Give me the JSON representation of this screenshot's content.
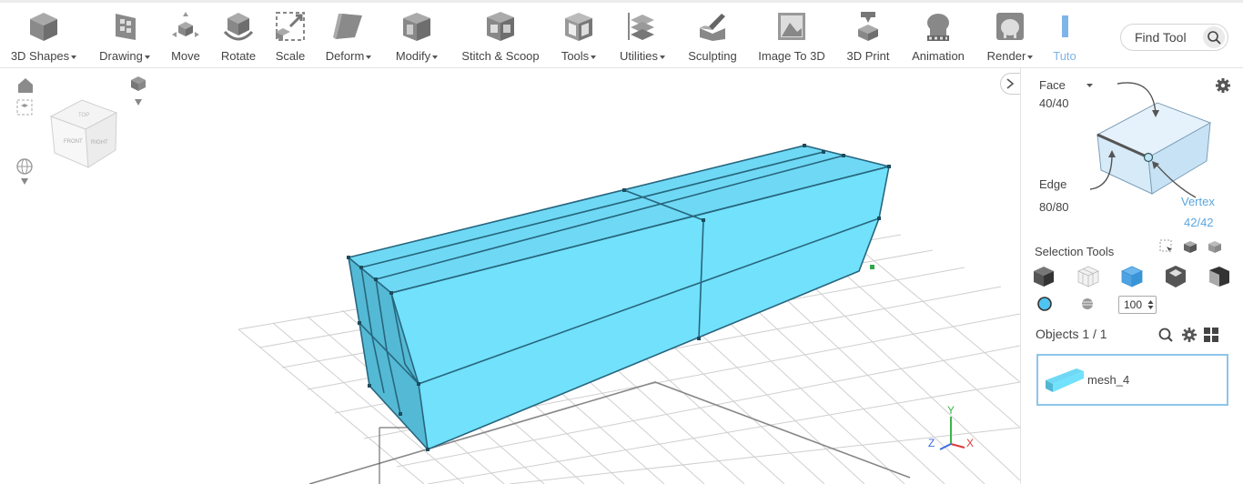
{
  "toolbar": {
    "tools": [
      {
        "label": "3D Shapes",
        "dropdown": true,
        "icon": "cube-icon"
      },
      {
        "label": "Drawing",
        "dropdown": true,
        "icon": "drawing-icon"
      },
      {
        "label": "Move",
        "dropdown": false,
        "icon": "move-icon"
      },
      {
        "label": "Rotate",
        "dropdown": false,
        "icon": "rotate-icon"
      },
      {
        "label": "Scale",
        "dropdown": false,
        "icon": "scale-icon"
      },
      {
        "label": "Deform",
        "dropdown": true,
        "icon": "deform-icon"
      },
      {
        "label": "Modify",
        "dropdown": true,
        "icon": "modify-icon"
      },
      {
        "label": "Stitch & Scoop",
        "dropdown": false,
        "icon": "stitch-scoop-icon"
      },
      {
        "label": "Tools",
        "dropdown": true,
        "icon": "tools-icon"
      },
      {
        "label": "Utilities",
        "dropdown": true,
        "icon": "utilities-icon"
      },
      {
        "label": "Sculpting",
        "dropdown": false,
        "icon": "sculpting-icon"
      },
      {
        "label": "Image To 3D",
        "dropdown": false,
        "icon": "image-to-3d-icon"
      },
      {
        "label": "3D Print",
        "dropdown": false,
        "icon": "3d-print-icon"
      },
      {
        "label": "Animation",
        "dropdown": false,
        "icon": "animation-icon"
      },
      {
        "label": "Render",
        "dropdown": true,
        "icon": "render-icon"
      },
      {
        "label": "Tuto",
        "dropdown": false,
        "icon": "tutorial-icon"
      }
    ],
    "find_tool": "Find Tool"
  },
  "viewcube": {
    "face_front": "FRONT",
    "face_right": "RIGHT",
    "face_top": "TOP"
  },
  "axes": {
    "y": "Y",
    "x": "X",
    "z": "Z"
  },
  "panel": {
    "face_label": "Face",
    "face_count": "40/40",
    "edge_label": "Edge",
    "edge_count": "80/80",
    "vertex_label": "Vertex",
    "vertex_count": "42/42",
    "selection_tools": "Selection Tools",
    "brush_size": "100",
    "objects_label": "Objects 1 / 1",
    "object_name": "mesh_4"
  },
  "colors": {
    "mesh": "#72e0fb",
    "mesh_dark": "#51b6d1",
    "accent": "#5aa7e0"
  }
}
